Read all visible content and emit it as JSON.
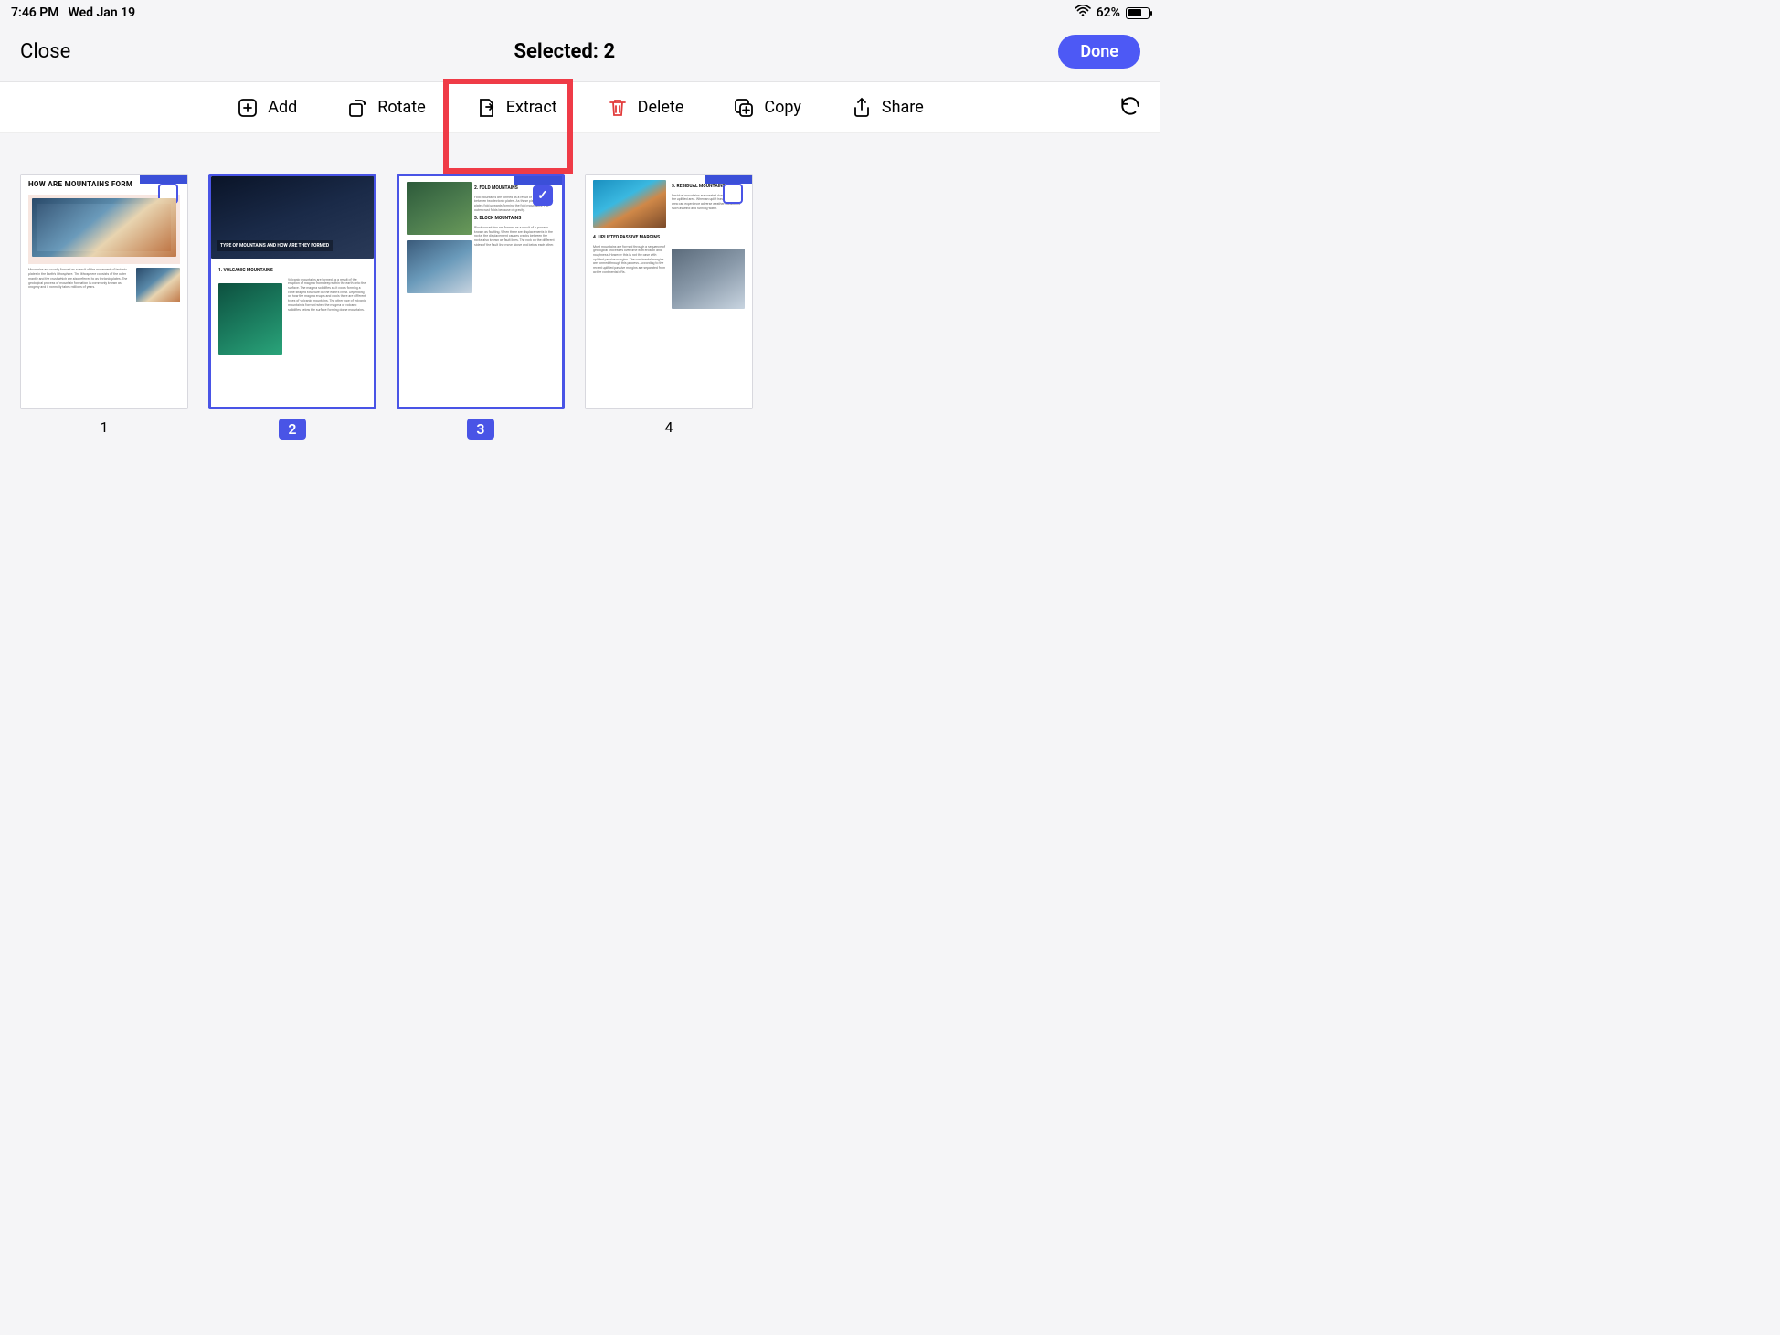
{
  "status": {
    "time": "7:46 PM",
    "date": "Wed Jan 19",
    "battery": "62%"
  },
  "header": {
    "close": "Close",
    "title": "Selected: 2",
    "done": "Done"
  },
  "toolbar": {
    "add": "Add",
    "rotate": "Rotate",
    "extract": "Extract",
    "delete": "Delete",
    "copy": "Copy",
    "share": "Share"
  },
  "pages": [
    {
      "num": "1",
      "selected": false,
      "title": "HOW ARE MOUNTAINS FORM"
    },
    {
      "num": "2",
      "selected": true,
      "title": "TYPE OF MOUNTAINS AND HOW ARE THEY FORMED",
      "sub": "1. VOLCANIC MOUNTAINS"
    },
    {
      "num": "3",
      "selected": true,
      "sub1": "2. FOLD MOUNTAINS",
      "sub2": "3. BLOCK MOUNTAINS"
    },
    {
      "num": "4",
      "selected": false,
      "sub1": "4. UPLIFTED PASSIVE MARGINS",
      "sub2": "5. RESIDUAL MOUNTAINS"
    }
  ]
}
